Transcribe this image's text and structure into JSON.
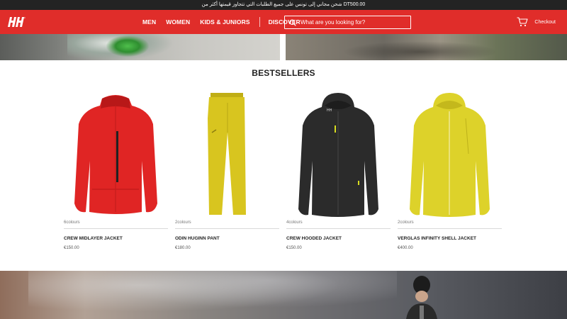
{
  "topbar": {
    "promo_text": "شحن مجاني إلى تونس على جميع الطلبات التي تتجاوز قيمتها أكثر من DT500.00"
  },
  "header": {
    "brand": "HH",
    "nav": [
      {
        "label": "MEN"
      },
      {
        "label": "WOMEN"
      },
      {
        "label": "KIDS & JUNIORS"
      },
      {
        "label": "DISCOVER"
      }
    ],
    "search": {
      "placeholder": "What are you looking for?",
      "value": ""
    },
    "checkout_label": "Checkout"
  },
  "bestsellers": {
    "title": "BESTSELLERS",
    "products": [
      {
        "colours": "6colours",
        "name": "CREW MIDLAYER JACKET",
        "price": "€150.00",
        "color": "#e02524"
      },
      {
        "colours": "2colours",
        "name": "ODIN HUGINN PANT",
        "price": "€180.00",
        "color": "#d8c51f"
      },
      {
        "colours": "4colours",
        "name": "CREW HOODED JACKET",
        "price": "€150.00",
        "color": "#2b2b2b"
      },
      {
        "colours": "2colours",
        "name": "VERGLAS INFINITY SHELL JACKET",
        "price": "€400.00",
        "color": "#ddd22a"
      }
    ]
  },
  "colors": {
    "brand_red": "#e02d2a",
    "topbar_bg": "#232323"
  }
}
